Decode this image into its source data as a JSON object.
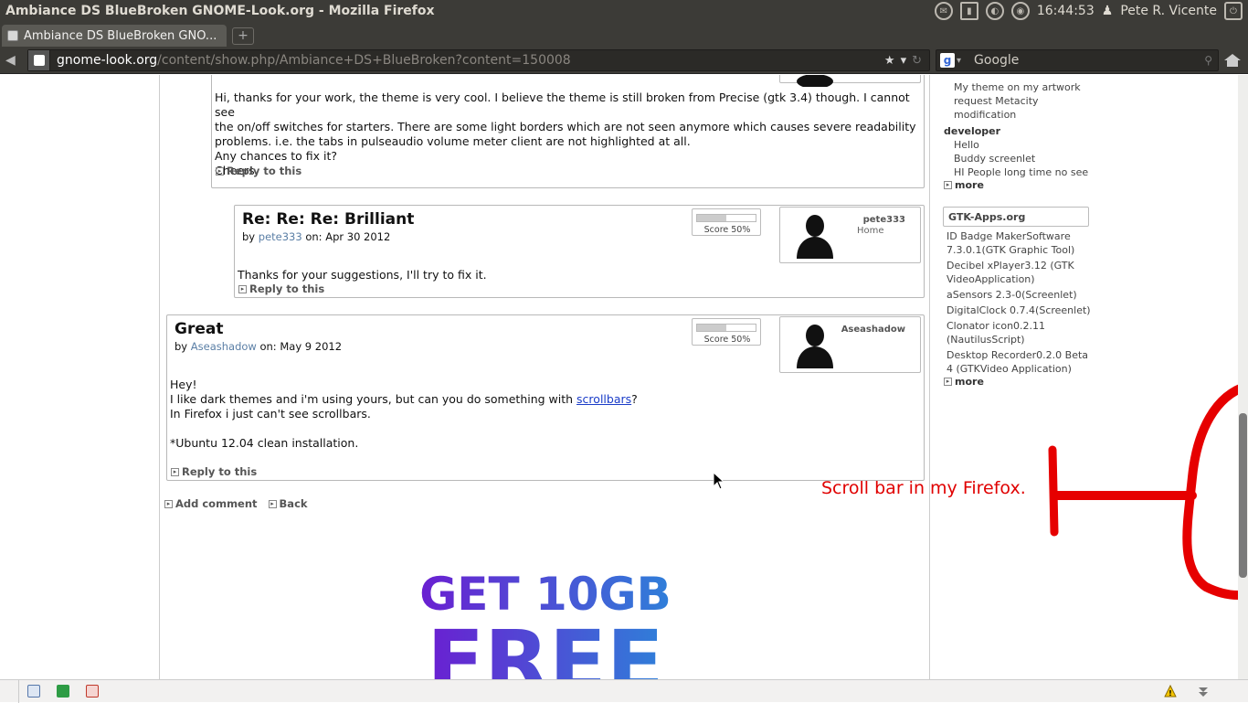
{
  "window": {
    "title": "Ambiance DS BlueBroken GNOME-Look.org - Mozilla Firefox",
    "clock": "16:44:53",
    "user": "Pete R. Vicente"
  },
  "tabs": [
    {
      "label": "Ambiance DS BlueBroken GNO..."
    }
  ],
  "newtab_label": "+",
  "navbar": {
    "url_host": "gnome-look.org",
    "url_path": "/content/show.php/Ambiance+DS+BlueBroken?content=150008",
    "search_placeholder": "Google",
    "search_engine_icon": "google-logo"
  },
  "comments": [
    {
      "body_lines": [
        "Hi, thanks for your work, the theme is very cool. I believe the theme is still broken from Precise (gtk 3.4) though. I cannot see",
        "the on/off switches for starters. There are some light borders which are not seen anymore which causes severe readability",
        "problems. i.e. the tabs in pulseaudio volume meter client are not highlighted at all.",
        "Any chances to fix it?",
        "Cheers."
      ],
      "reply": "Reply to this"
    },
    {
      "title": "Re: Re: Re: Brilliant",
      "by": "by",
      "author": "pete333",
      "on": "on:",
      "date": "Apr 30 2012",
      "body_lines": [
        "Thanks for your suggestions, I'll try to fix it."
      ],
      "reply": "Reply to this",
      "score_label": "Score 50%",
      "score": 0.5,
      "user_name": "pete333",
      "user_location": "Home"
    },
    {
      "title": "Great",
      "by": "by",
      "author": "Aseashadow",
      "on": "on:",
      "date": "May 9 2012",
      "body_lines": [
        "Hey!",
        "I like dark themes and i'm using yours, but can you do something with",
        "In Firefox i just can't see scrollbars.",
        "",
        "*Ubuntu 12.04 clean installation."
      ],
      "link_text": "scrollbars",
      "link_suffix": "?",
      "reply": "Reply to this",
      "score_label": "Score 50%",
      "score": 0.5,
      "user_name": "Aseashadow"
    }
  ],
  "page_links": {
    "add_comment": "Add comment",
    "back": "Back"
  },
  "ad": {
    "line1": "GET 10GB",
    "line2": "FREE"
  },
  "sidebar": {
    "top_items": [
      "My theme on my artwork",
      "request Metacity",
      "modification"
    ],
    "developer_heading": "developer",
    "developer_items": [
      "Hello",
      "Buddy screenlet",
      "HI People long time no see"
    ],
    "more1": "more",
    "gtk_heading": "GTK-Apps.org",
    "gtk_items": [
      "ID Badge MakerSoftware",
      "7.3.0.1(GTK Graphic Tool)",
      "Decibel xPlayer3.12 (GTK",
      "VideoApplication)",
      "aSensors 2.3-0(Screenlet)",
      "DigitalClock 0.7.4(Screenlet)",
      "Clonator icon0.2.11",
      "(NautilusScript)",
      "Desktop Recorder0.2.0 Beta",
      "4 (GTKVideo Application)"
    ],
    "more2": "more"
  },
  "annotation": {
    "text": "Scroll bar in my Firefox.",
    "color": "#e00000"
  },
  "colors": {
    "panel": "#3c3b37",
    "link": "#5b7fa6",
    "ad_gradient_start": "#6a1fd1",
    "ad_gradient_end": "#2f7fd9"
  }
}
